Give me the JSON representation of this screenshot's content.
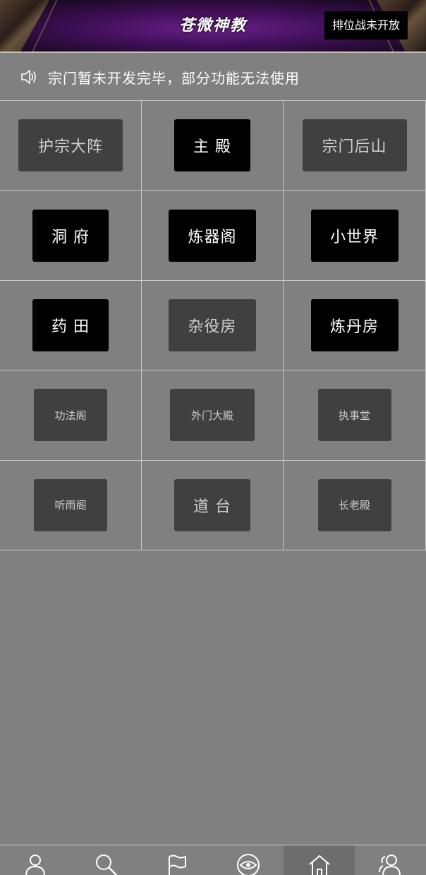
{
  "header": {
    "title": "苍微神教",
    "rank_button": "排位战未开放"
  },
  "notice": {
    "icon": "speaker-icon",
    "text": "宗门暂未开发完毕，部分功能无法使用"
  },
  "grid": {
    "buttons": [
      {
        "label": "护宗大阵",
        "state": "disabled"
      },
      {
        "label": "主 殿",
        "state": "enabled"
      },
      {
        "label": "宗门后山",
        "state": "disabled"
      },
      {
        "label": "洞 府",
        "state": "enabled"
      },
      {
        "label": "炼器阁",
        "state": "enabled"
      },
      {
        "label": "小世界",
        "state": "enabled"
      },
      {
        "label": "药 田",
        "state": "enabled"
      },
      {
        "label": "杂役房",
        "state": "disabled"
      },
      {
        "label": "炼丹房",
        "state": "enabled"
      },
      {
        "label": "功法阁",
        "state": "disabled"
      },
      {
        "label": "外门大殿",
        "state": "disabled"
      },
      {
        "label": "执事堂",
        "state": "disabled"
      },
      {
        "label": "听雨阁",
        "state": "disabled"
      },
      {
        "label": "道 台",
        "state": "disabled"
      },
      {
        "label": "长老殿",
        "state": "disabled"
      }
    ]
  },
  "bottom_nav": {
    "items": [
      {
        "icon": "user-icon"
      },
      {
        "icon": "search-icon"
      },
      {
        "icon": "flag-icon"
      },
      {
        "icon": "eye-icon"
      },
      {
        "icon": "home-icon",
        "active": true
      },
      {
        "icon": "group-icon"
      }
    ]
  },
  "colors": {
    "background": "#808080",
    "enabled_button": "#000000",
    "disabled_button": "#404040",
    "header_purple": "#4a1466"
  }
}
